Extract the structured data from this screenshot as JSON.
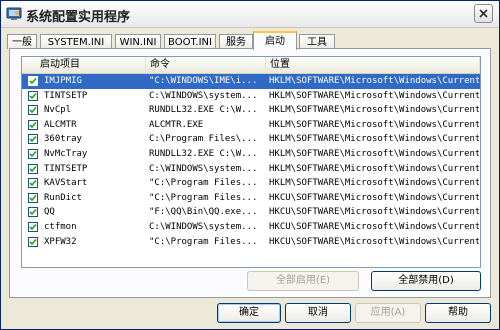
{
  "window": {
    "title": "系统配置实用程序"
  },
  "tabs": [
    {
      "label": "一般"
    },
    {
      "label": "SYSTEM.INI"
    },
    {
      "label": "WIN.INI"
    },
    {
      "label": "BOOT.INI"
    },
    {
      "label": "服务"
    },
    {
      "label": "启动"
    },
    {
      "label": "工具"
    }
  ],
  "active_tab": "启动",
  "startup": {
    "columns": [
      "启动项目",
      "命令",
      "位置"
    ],
    "rows": [
      {
        "item": "IMJPMIG",
        "command": "\"C:\\WINDOWS\\IME\\i...",
        "location": "HKLM\\SOFTWARE\\Microsoft\\Windows\\Current...",
        "checked": true
      },
      {
        "item": "TINTSETP",
        "command": "C:\\WINDOWS\\system...",
        "location": "HKLM\\SOFTWARE\\Microsoft\\Windows\\Current...",
        "checked": true
      },
      {
        "item": "NvCpl",
        "command": "RUNDLL32.EXE C:\\W...",
        "location": "HKLM\\SOFTWARE\\Microsoft\\Windows\\Current...",
        "checked": true
      },
      {
        "item": "ALCMTR",
        "command": "ALCMTR.EXE",
        "location": "HKLM\\SOFTWARE\\Microsoft\\Windows\\Current...",
        "checked": true
      },
      {
        "item": "360tray",
        "command": "C:\\Program Files\\...",
        "location": "HKLM\\SOFTWARE\\Microsoft\\Windows\\Current...",
        "checked": true
      },
      {
        "item": "NvMcTray",
        "command": "RUNDLL32.EXE C:\\W...",
        "location": "HKLM\\SOFTWARE\\Microsoft\\Windows\\Current...",
        "checked": true
      },
      {
        "item": "TINTSETP",
        "command": "C:\\WINDOWS\\system...",
        "location": "HKLM\\SOFTWARE\\Microsoft\\Windows\\Current...",
        "checked": true
      },
      {
        "item": "KAVStart",
        "command": "\"C:\\Program Files...",
        "location": "HKLM\\SOFTWARE\\Microsoft\\Windows\\Current...",
        "checked": true
      },
      {
        "item": "RunDict",
        "command": "\"C:\\Program Files...",
        "location": "HKCU\\SOFTWARE\\Microsoft\\Windows\\Current...",
        "checked": true
      },
      {
        "item": "QQ",
        "command": "\"F:\\QQ\\Bin\\QQ.exe...",
        "location": "HKCU\\SOFTWARE\\Microsoft\\Windows\\Current...",
        "checked": true
      },
      {
        "item": "ctfmon",
        "command": "C:\\WINDOWS\\system...",
        "location": "HKCU\\SOFTWARE\\Microsoft\\Windows\\Current...",
        "checked": true
      },
      {
        "item": "XPFW32",
        "command": "\"C:\\Program Files...",
        "location": "HKCU\\SOFTWARE\\Microsoft\\Windows\\Current...",
        "checked": true
      }
    ],
    "selected_row": 0
  },
  "buttons": {
    "enable_all": "全部启用(E)",
    "disable_all": "全部禁用(D)",
    "ok": "确定",
    "cancel": "取消",
    "apply": "应用(A)",
    "help": "帮助"
  },
  "colors": {
    "selection": "#316ac5",
    "tab_highlight": "#ffc83c",
    "dialog_bg": "#ece9d8"
  },
  "icons": {
    "app": "system-config-icon",
    "close": "close-icon",
    "check": "checkmark-icon"
  }
}
